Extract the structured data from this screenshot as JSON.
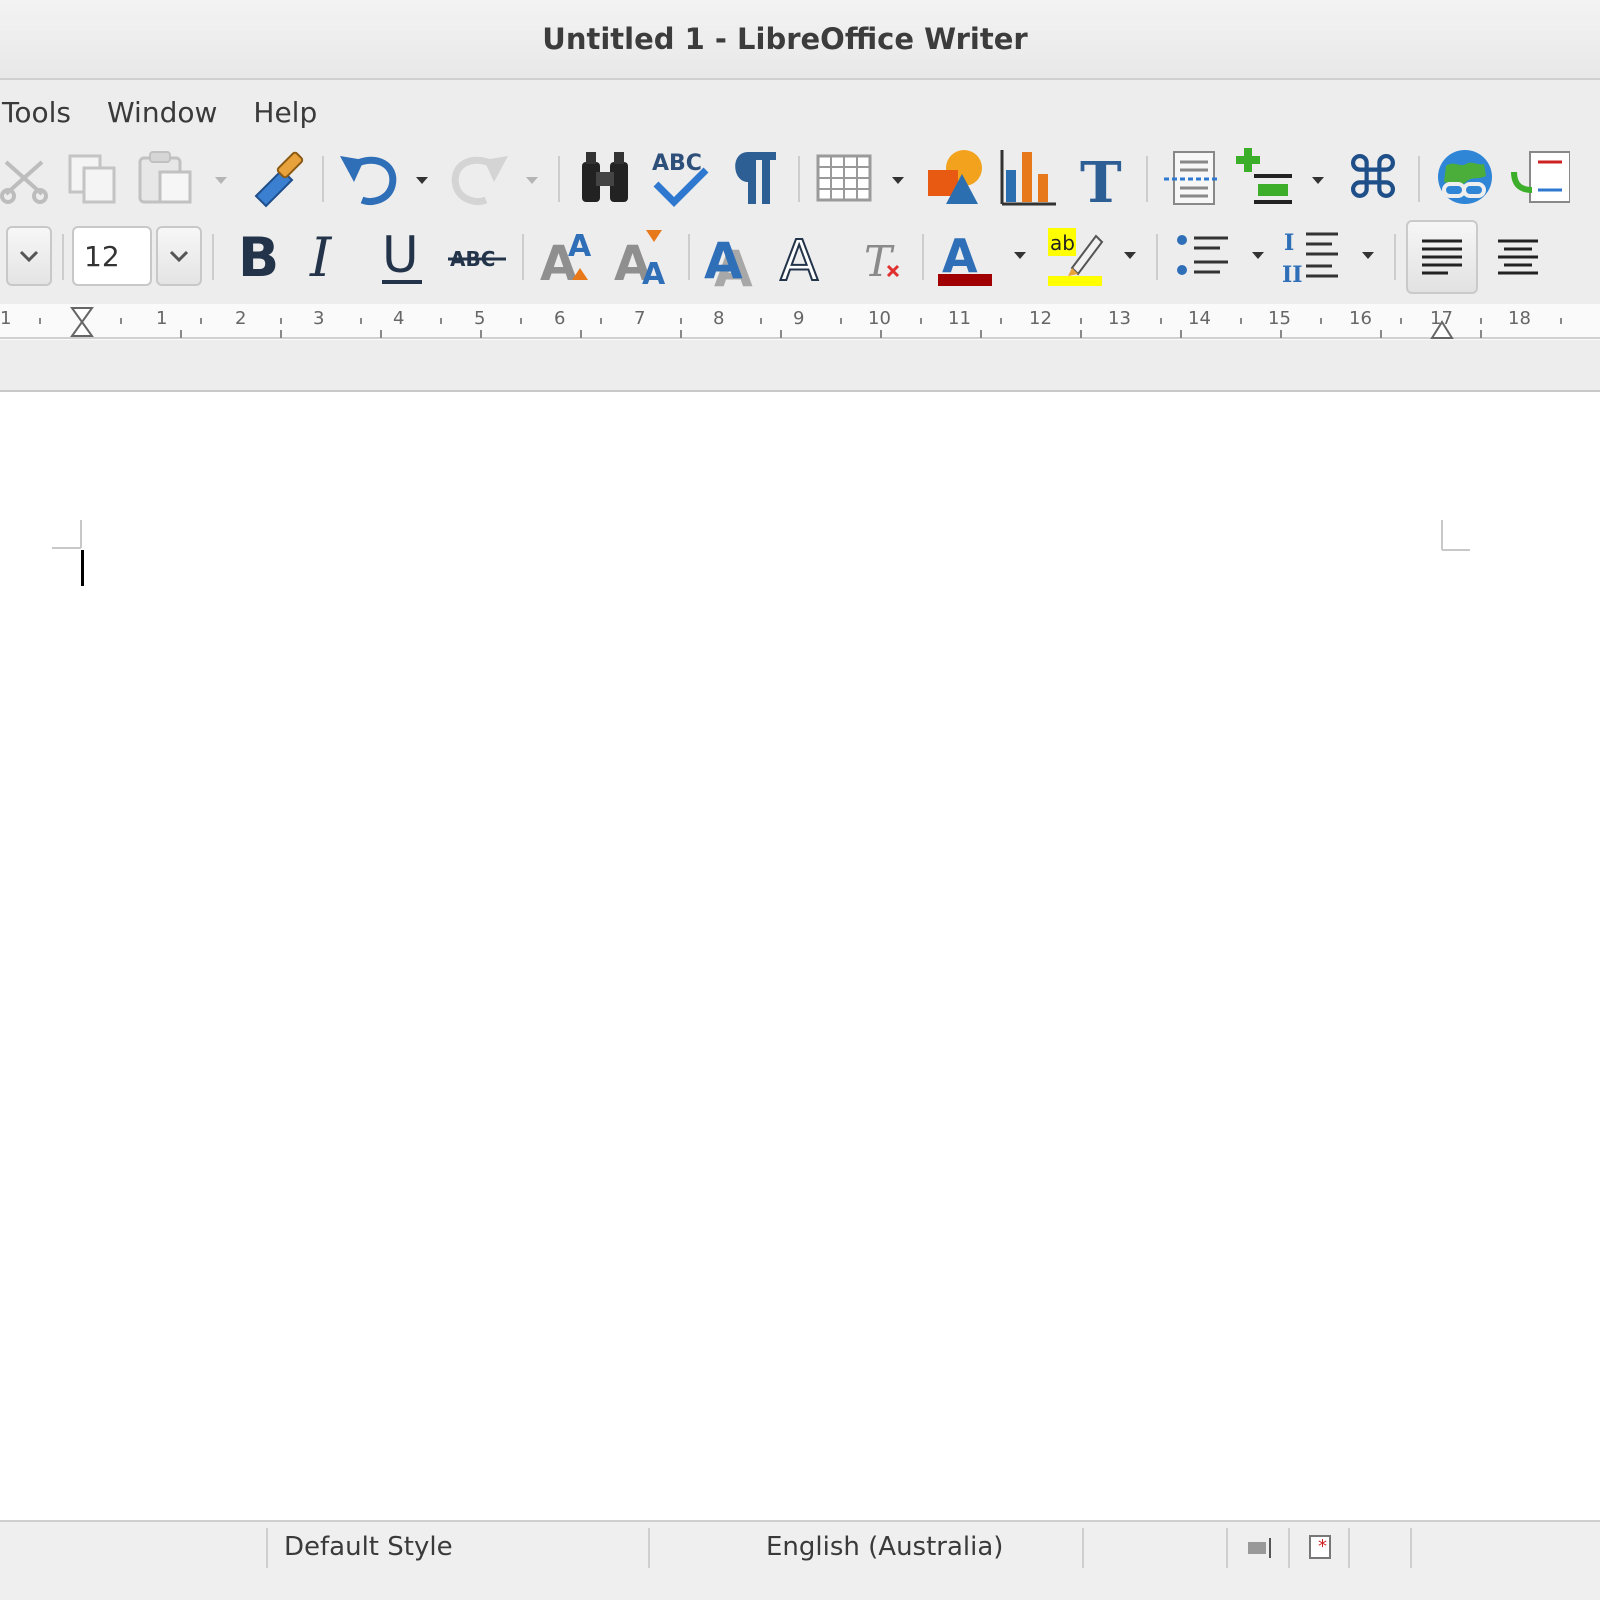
{
  "window": {
    "title": "Untitled 1 - LibreOffice Writer"
  },
  "menubar": {
    "items": [
      "Tools",
      "Window",
      "Help"
    ]
  },
  "toolbar_standard": {
    "icons": [
      "cut-icon",
      "copy-icon",
      "paste-icon",
      "clone-formatting-icon",
      "undo-icon",
      "redo-icon",
      "find-replace-icon",
      "spelling-icon",
      "formatting-marks-icon",
      "insert-table-icon",
      "insert-image-icon",
      "insert-chart-icon",
      "insert-text-box-icon",
      "insert-page-break-icon",
      "insert-field-icon",
      "insert-special-character-icon",
      "insert-hyperlink-icon",
      "insert-footnote-icon"
    ]
  },
  "toolbar_formatting": {
    "font_size": "12",
    "icons": [
      "bold-icon",
      "italic-icon",
      "underline-icon",
      "strikethrough-icon",
      "superscript-icon",
      "subscript-icon",
      "shadow-icon",
      "outline-icon",
      "clear-formatting-icon",
      "font-color-icon",
      "highlight-icon",
      "unordered-list-icon",
      "ordered-list-icon",
      "align-left-icon",
      "align-center-icon"
    ],
    "colors": {
      "font_color": "#a00000",
      "highlight": "#ffff00"
    }
  },
  "ruler": {
    "labels": [
      "1",
      "1",
      "2",
      "3",
      "4",
      "5",
      "6",
      "7",
      "8",
      "9",
      "10",
      "11",
      "12",
      "13",
      "14",
      "15",
      "16",
      "17",
      "18"
    ]
  },
  "statusbar": {
    "page_style": "Default Style",
    "language": "English (Australia)"
  }
}
